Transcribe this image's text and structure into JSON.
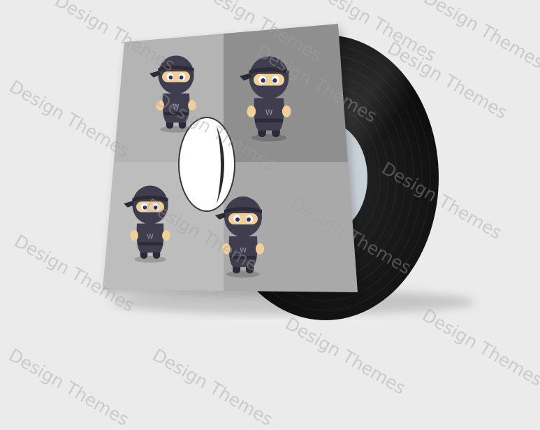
{
  "watermark": {
    "text": "Design Themes",
    "color": "#a0a0a0"
  },
  "scene": {
    "background": "#ebebeb",
    "sleeve_quadrant_colors": [
      "#b4b4b4",
      "#8f8f8f",
      "#bdbdbd",
      "#a9a9a9"
    ],
    "record_color": "#151515",
    "label_color": "#c9d1d8",
    "mascot": {
      "name": "ninja",
      "count": 4,
      "suit_color": "#3f3d4e",
      "skin_color": "#f1cf9b",
      "eye_color": "#2f2f6e",
      "chest_letter": "W"
    }
  }
}
